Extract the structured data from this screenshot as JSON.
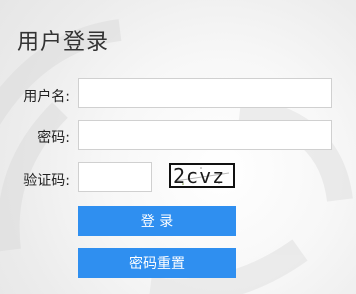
{
  "form": {
    "title": "用户登录",
    "username_label": "用户名:",
    "username_value": "",
    "password_label": "密码:",
    "password_value": "",
    "captcha_label": "验证码:",
    "captcha_value": "",
    "captcha_image_text": "2cvz"
  },
  "buttons": {
    "login_label": "登  录",
    "reset_label": "密码重置"
  },
  "colors": {
    "accent": "#2f8ff0",
    "title_text": "#333333",
    "field_border": "#d0d0d0",
    "background": "#ececec"
  },
  "icons": {
    "background": "watermark-logo-icon"
  }
}
